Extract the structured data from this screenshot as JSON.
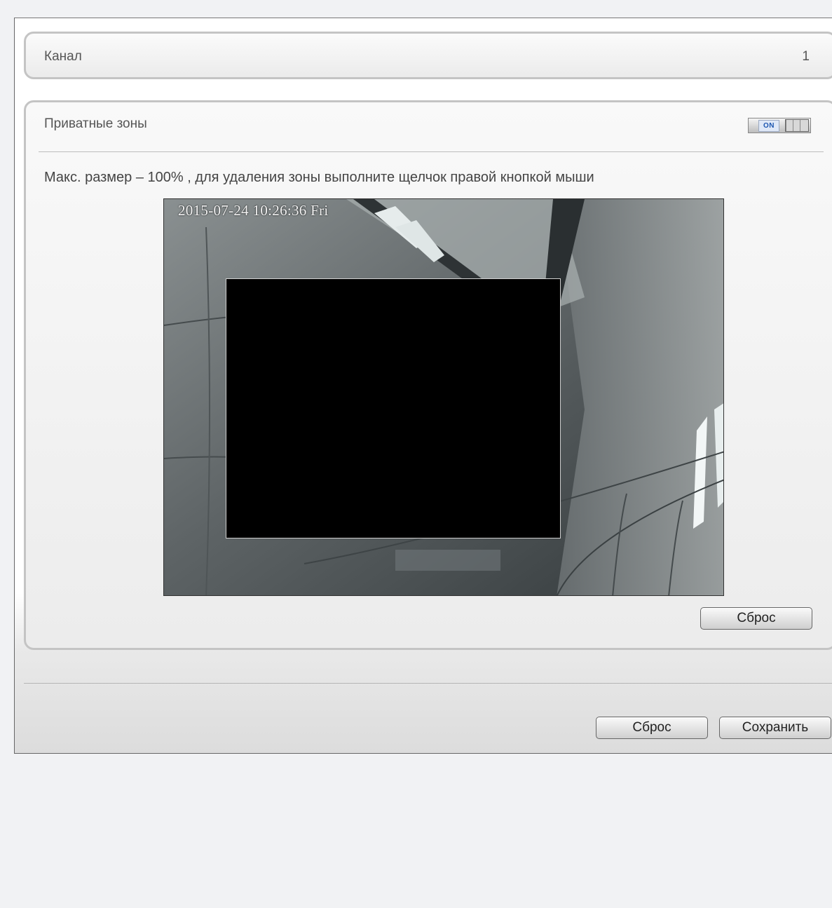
{
  "channel": {
    "label": "Канал",
    "value": "1"
  },
  "privacy": {
    "title": "Приватные зоны",
    "toggle": {
      "state_label": "ON",
      "enabled": true
    },
    "hint": "Макс. размер – 100% , для удаления зоны выполните щелчок правой кнопкой мыши",
    "video": {
      "osd_timestamp": "2015-07-24 10:26:36 Fri"
    },
    "reset_label": "Сброс"
  },
  "footer": {
    "reset_label": "Сброс",
    "save_label": "Сохранить"
  },
  "colors": {
    "toggle_on_text": "#1c56b0",
    "mask": "#000000",
    "panel_border": "#c4c4c4"
  }
}
